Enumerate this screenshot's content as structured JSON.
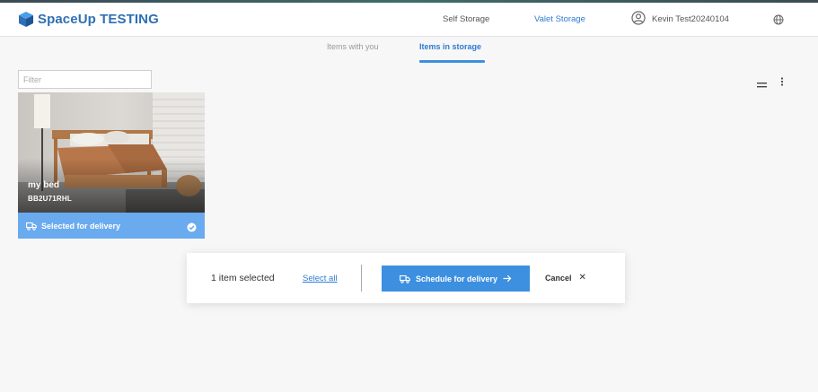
{
  "header": {
    "app_title": "SpaceUp TESTING",
    "nav": [
      "Self Storage",
      "Valet Storage"
    ],
    "active_nav": "Valet Storage",
    "user_name": "Kevin Test20240104"
  },
  "tabs": {
    "items": [
      "Items with you",
      "Items in storage"
    ],
    "active": "Items in storage"
  },
  "filter": {
    "placeholder": "Filter",
    "value": ""
  },
  "items": [
    {
      "name": "my bed",
      "code": "BB2U71RHL",
      "status": "Selected for delivery",
      "selected": true
    }
  ],
  "action_bar": {
    "selected_text": "1 item selected",
    "select_all": "Select all",
    "schedule_button": "Schedule for delivery",
    "cancel_button": "Cancel"
  },
  "colors": {
    "brand": "#2f6fb4",
    "accent": "#3d8fe0",
    "selected_footer": "#6aaaef"
  },
  "icons": [
    "cube-logo-icon",
    "user-circle-icon",
    "globe-icon",
    "list-view-icon",
    "more-vertical-icon",
    "truck-icon",
    "check-circle-icon",
    "arrow-right-icon",
    "close-icon"
  ]
}
